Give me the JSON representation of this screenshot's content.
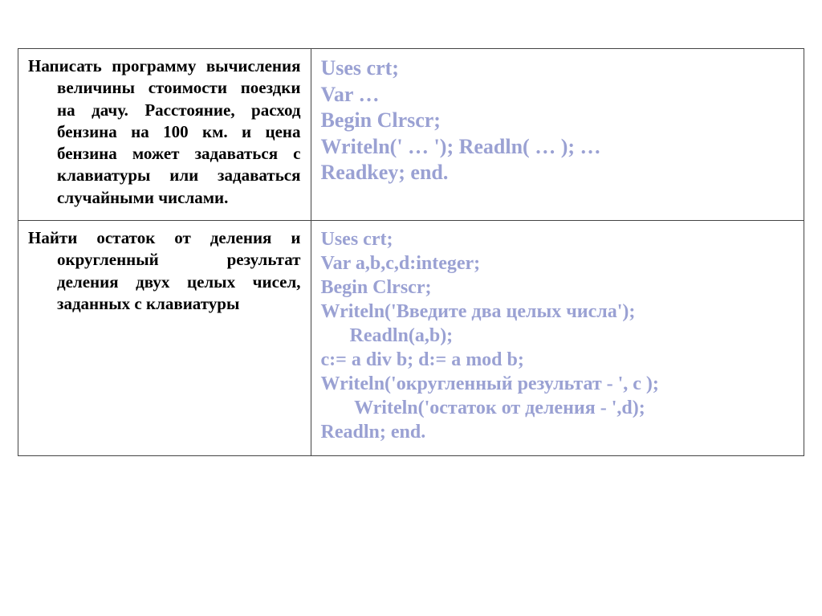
{
  "rows": [
    {
      "task": "Написать программу вычисления величины стоимости поездки на дачу. Расстояние, расход бензина на 100 км. и цена бензина может задаваться с клавиатуры или задаваться случайными числами.",
      "code_lines": [
        "Uses crt;",
        "Var …",
        "Begin  Clrscr;",
        "Writeln(' … '); Readln( … );   …",
        "Readkey;  end."
      ]
    },
    {
      "task": "Найти остаток от деления и округленный результат деления двух целых чисел, заданных с клавиатуры",
      "code_lines": [
        "Uses crt;",
        "Var a,b,c,d:integer;",
        "Begin Clrscr;",
        "Writeln('Введите два целых числа');",
        "      Readln(a,b);",
        "c:= a div b; d:= a mod b;",
        "Writeln('округленный результат - ', c );",
        "       Writeln('остаток от деления - ',d);",
        "Readln; end."
      ]
    }
  ]
}
